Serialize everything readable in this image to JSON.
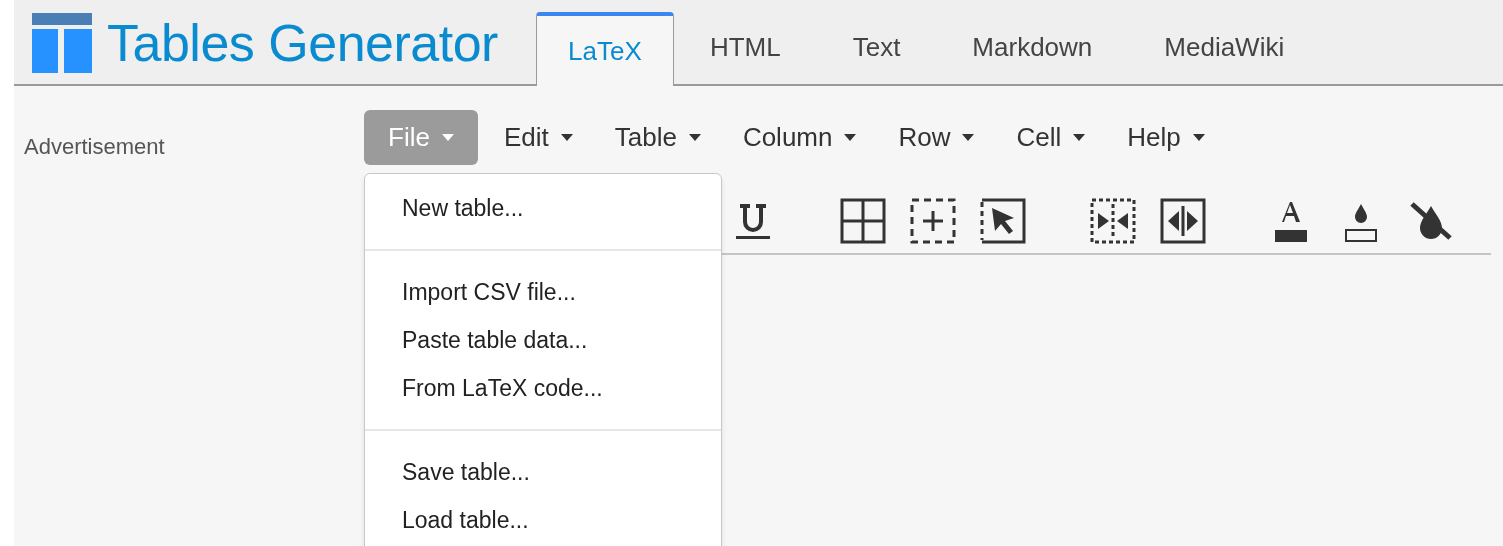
{
  "header": {
    "title": "Tables Generator"
  },
  "tabs": [
    {
      "label": "LaTeX",
      "selected": true
    },
    {
      "label": "HTML",
      "selected": false
    },
    {
      "label": "Text",
      "selected": false
    },
    {
      "label": "Markdown",
      "selected": false
    },
    {
      "label": "MediaWiki",
      "selected": false
    }
  ],
  "sidebar": {
    "label": "Advertisement"
  },
  "menus": [
    {
      "label": "File",
      "selected": true
    },
    {
      "label": "Edit",
      "selected": false
    },
    {
      "label": "Table",
      "selected": false
    },
    {
      "label": "Column",
      "selected": false
    },
    {
      "label": "Row",
      "selected": false
    },
    {
      "label": "Cell",
      "selected": false
    },
    {
      "label": "Help",
      "selected": false
    }
  ],
  "dropdown": {
    "sections": [
      [
        "New table..."
      ],
      [
        "Import CSV file...",
        "Paste table data...",
        "From LaTeX code..."
      ],
      [
        "Save table...",
        "Load table..."
      ]
    ]
  }
}
